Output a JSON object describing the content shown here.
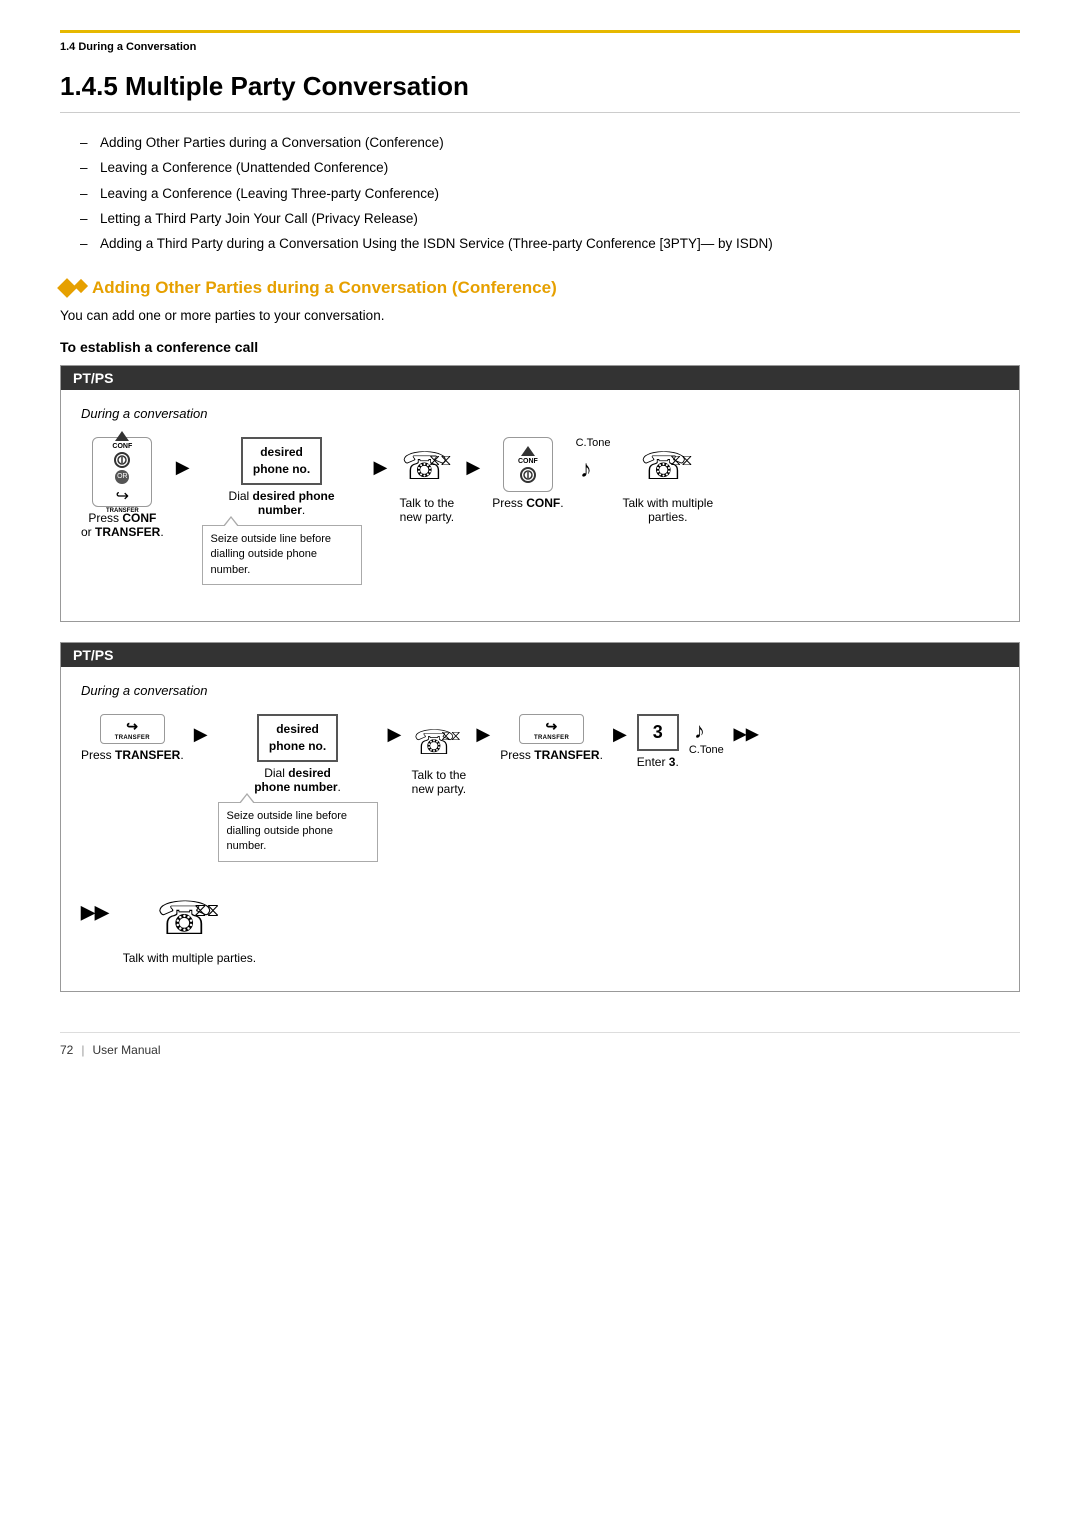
{
  "header": {
    "section": "1.4 During a Conversation"
  },
  "title": "1.4.5   Multiple Party Conversation",
  "bullets": [
    "Adding Other Parties during a Conversation (Conference)",
    "Leaving a Conference (Unattended Conference)",
    "Leaving a Conference (Leaving Three-party Conference)",
    "Letting a Third Party Join Your Call (Privacy Release)",
    "Adding a Third Party during a Conversation Using the ISDN Service (Three-party Conference [3PTY]— by ISDN)"
  ],
  "section_heading": "Adding Other Parties during a Conversation (Conference)",
  "section_desc": "You can add one or more parties to your conversation.",
  "subsection_title": "To establish a conference call",
  "box1": {
    "label": "PT/PS",
    "during": "During a conversation",
    "steps": [
      {
        "action": "Press ",
        "bold": "CONF",
        "action2": " or ",
        "bold2": "TRANSFER",
        "text": "Press CONF or TRANSFER."
      },
      {
        "text": "Dial desired phone number."
      },
      {
        "text": "Talk to the new party."
      },
      {
        "text": "Press CONF."
      },
      {
        "text": "Talk with multiple parties."
      }
    ],
    "note": "Seize outside line before dialling outside phone number.",
    "desired_phone": "desired\nphone no.",
    "ctone": "C.Tone"
  },
  "box2": {
    "label": "PT/PS",
    "during": "During a conversation",
    "steps": [
      {
        "text": "Press TRANSFER."
      },
      {
        "text": "Dial desired phone number."
      },
      {
        "text": "Talk to the new party."
      },
      {
        "text": "Press TRANSFER."
      },
      {
        "text": "Enter 3."
      },
      {
        "text": "Talk with multiple parties."
      }
    ],
    "note": "Seize outside line before dialling outside phone number.",
    "desired_phone": "desired\nphone no.",
    "number": "3",
    "ctone": "C.Tone"
  },
  "footer": {
    "page": "72",
    "manual": "User Manual"
  }
}
